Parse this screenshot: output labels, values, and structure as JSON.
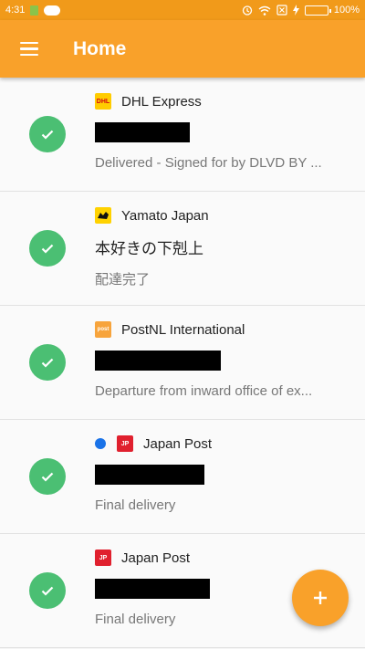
{
  "status_bar": {
    "time": "4:31",
    "battery": "100%"
  },
  "toolbar": {
    "title": "Home"
  },
  "colors": {
    "primary": "#f9a12a",
    "status_bar": "#f19a1a",
    "delivered_green": "#4bbf73",
    "unread_dot": "#1a73e8"
  },
  "shipments": [
    {
      "courier": "DHL Express",
      "courier_icon": "dhl-logo-icon",
      "name": "",
      "name_redacted": true,
      "status": "Delivered - Signed for by DLVD BY ...",
      "unread": false
    },
    {
      "courier": "Yamato Japan",
      "courier_icon": "yamato-logo-icon",
      "name": "本好きの下剋上",
      "name_redacted": false,
      "status": "配達完了",
      "unread": false
    },
    {
      "courier": "PostNL International",
      "courier_icon": "postnl-logo-icon",
      "name": "",
      "name_redacted": true,
      "status": "Departure from inward office of ex...",
      "unread": false
    },
    {
      "courier": "Japan Post",
      "courier_icon": "japan-post-logo-icon",
      "name": "",
      "name_redacted": true,
      "status": "Final delivery",
      "unread": true
    },
    {
      "courier": "Japan Post",
      "courier_icon": "japan-post-logo-icon",
      "name": "",
      "name_redacted": true,
      "status": "Final delivery",
      "unread": false
    }
  ],
  "fab": {
    "icon": "plus-icon"
  }
}
